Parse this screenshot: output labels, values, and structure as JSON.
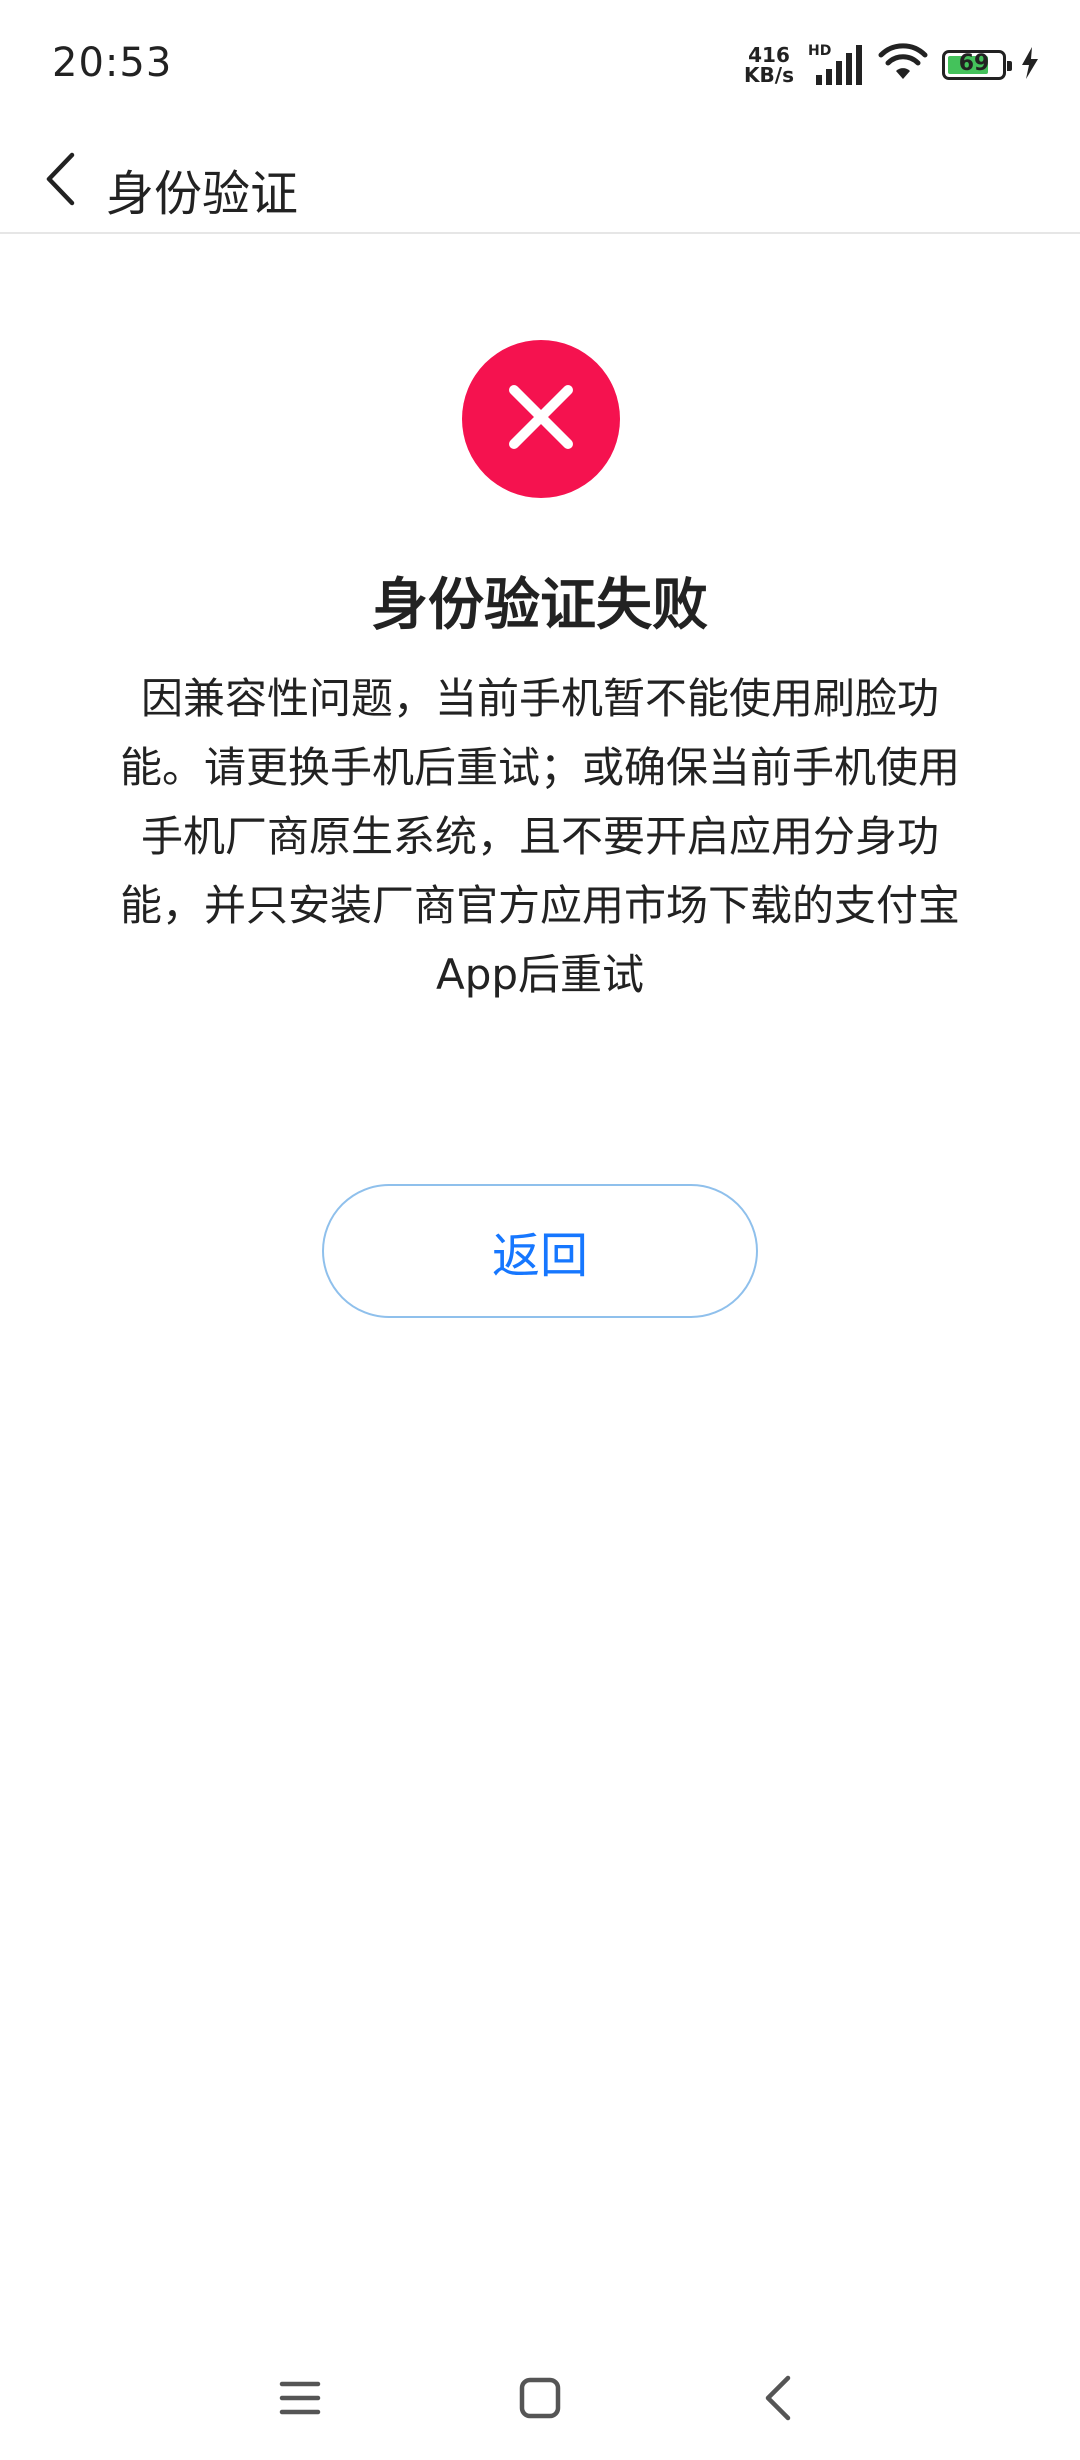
{
  "status_bar": {
    "time": "20:53",
    "net_speed_value": "416",
    "net_speed_unit": "KB/s",
    "hd_label": "HD",
    "battery_level": "69"
  },
  "header": {
    "title": "身份验证",
    "back_icon": "chevron-left-icon"
  },
  "result": {
    "icon": "close-icon",
    "icon_color": "#f5124f",
    "title": "身份验证失败",
    "message": "因兼容性问题，当前手机暂不能使用刷脸功能。请更换手机后重试；或确保当前手机使用手机厂商原生系统，且不要开启应用分身功能，并只安装厂商官方应用市场下载的支付宝App后重试"
  },
  "actions": {
    "return_label": "返回",
    "accent_color": "#1677ff"
  },
  "nav_bar": {
    "menu_icon": "menu-icon",
    "home_icon": "home-icon",
    "back_icon": "back-icon"
  }
}
